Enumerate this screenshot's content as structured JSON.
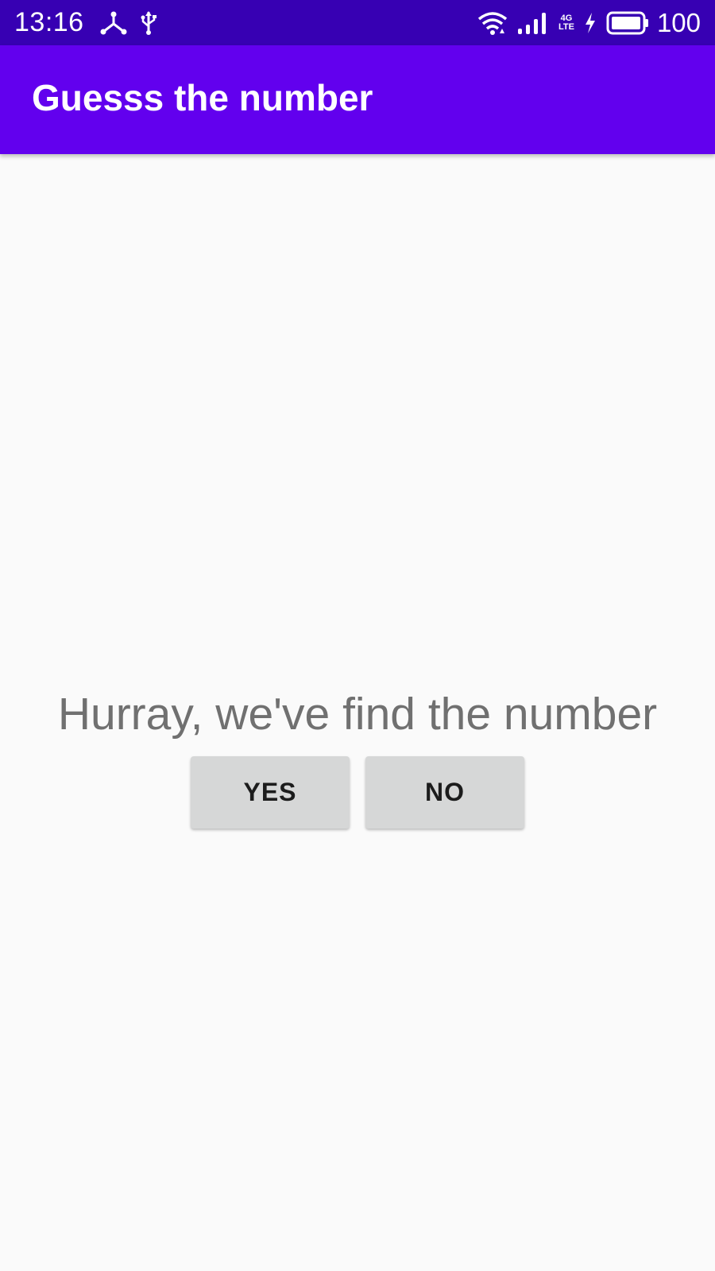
{
  "status_bar": {
    "time": "13:16",
    "network_top": "4G",
    "network_bottom": "LTE",
    "battery_level": "100",
    "icons": [
      "tethering-icon",
      "usb-icon",
      "wifi-icon",
      "signal-icon",
      "charging-icon",
      "battery-icon"
    ]
  },
  "app_bar": {
    "title": "Guesss the number"
  },
  "main": {
    "message": "Hurray, we've find the number",
    "yes_label": "YES",
    "no_label": "NO"
  },
  "colors": {
    "status_bar": "#3700b3",
    "app_bar": "#6200ee",
    "background": "#fafafa",
    "message_text": "#707070",
    "button_bg": "#d6d7d7"
  }
}
